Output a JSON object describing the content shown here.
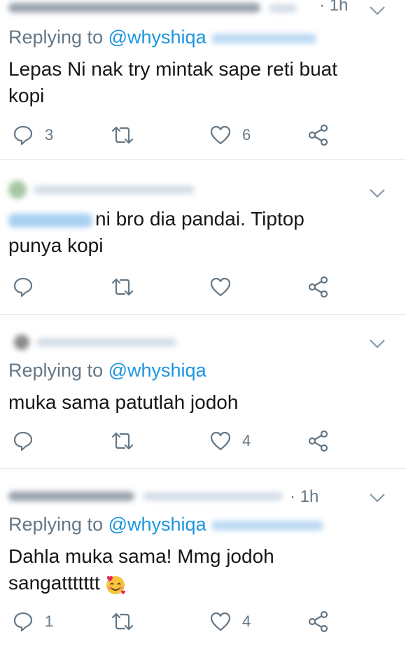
{
  "tweets": [
    {
      "time": "· 1h",
      "replying_prefix": "Replying to",
      "replying_handle": "@whyshiqa",
      "text_line1": "Lepas Ni nak try mintak sape reti buat",
      "text_line2": "kopi",
      "reply_count": "3",
      "like_count": "6"
    },
    {
      "text_line1": "ni bro dia pandai. Tiptop",
      "text_line2": "punya kopi"
    },
    {
      "replying_prefix": "Replying to",
      "replying_handle": "@whyshiqa",
      "text_line1": "muka sama patutlah jodoh",
      "like_count": "4"
    },
    {
      "time": "· 1h",
      "replying_prefix": "Replying to",
      "replying_handle": "@whyshiqa",
      "text_line1": "Dahla muka sama! Mmg jodoh",
      "text_line2": "sangattttttt",
      "reply_count": "1",
      "like_count": "4"
    }
  ],
  "icons": {
    "reply": "reply-icon",
    "retweet": "retweet-icon",
    "like": "heart-icon",
    "share": "share-icon",
    "caret": "chevron-down-icon",
    "emoji": "smiling-face-with-hearts-emoji"
  },
  "colors": {
    "text": "#14171a",
    "muted": "#657786",
    "link": "#1b95e0",
    "divider": "#e1e8ed"
  }
}
